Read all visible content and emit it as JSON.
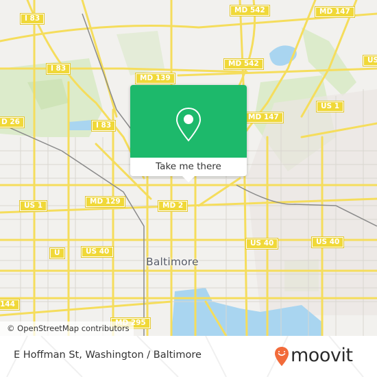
{
  "map": {
    "city_label": "Baltimore",
    "attribution": "© OpenStreetMap contributors",
    "road_shields": [
      {
        "label": "I 83"
      },
      {
        "label": "I 83"
      },
      {
        "label": "I 83"
      },
      {
        "label": "MD 542"
      },
      {
        "label": "MD 542"
      },
      {
        "label": "MD 147"
      },
      {
        "label": "MD 147"
      },
      {
        "label": "MD 139"
      },
      {
        "label": "US 1"
      },
      {
        "label": "US 1"
      },
      {
        "label": "D 26"
      },
      {
        "label": "MD 129"
      },
      {
        "label": "MD 2"
      },
      {
        "label": "US 40"
      },
      {
        "label": "U"
      },
      {
        "label": "US 40"
      },
      {
        "label": "US 40"
      },
      {
        "label": "144"
      },
      {
        "label": "MD 295"
      },
      {
        "label": "US"
      }
    ],
    "colors": {
      "road": "#f5dd5c",
      "background": "#f2f1ee",
      "park": "#d7e9c4",
      "water": "#a9d5f0"
    }
  },
  "popup": {
    "cta_label": "Take me there",
    "icon": "map-pin-icon",
    "color": "#1db96b"
  },
  "footer": {
    "location_title": "E Hoffman St, Washington / Baltimore",
    "brand": "moovit",
    "brand_color": "#f26b3a"
  }
}
